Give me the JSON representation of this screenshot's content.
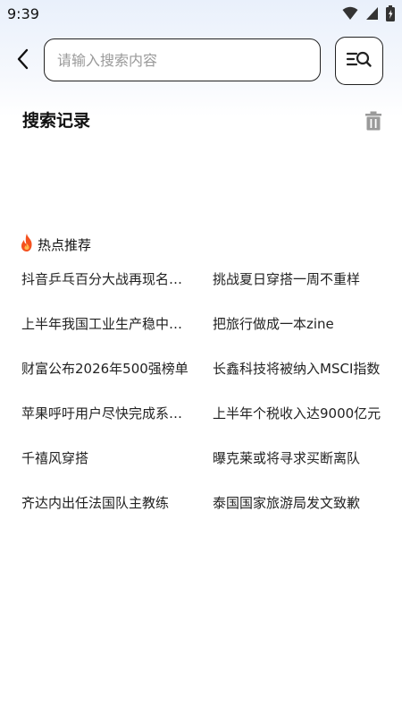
{
  "status_bar": {
    "time": "9:39",
    "icons": [
      "wifi-icon",
      "signal-icon",
      "battery-icon"
    ]
  },
  "header": {
    "back_icon": "chevron-left-icon",
    "search": {
      "placeholder": "请输入搜索内容",
      "value": ""
    },
    "search_button_icon": "search-list-icon"
  },
  "history": {
    "title": "搜索记录",
    "clear_icon": "trash-icon",
    "items": []
  },
  "hot": {
    "title": "热点推荐",
    "icon": "fire-icon",
    "accent": "#f4511e",
    "items": [
      "抖音乒乓百分大战再现名场面",
      "挑战夏日穿搭一周不重样",
      "上半年我国工业生产稳中有进",
      "把旅行做成一本zine",
      "财富公布2026年500强榜单",
      "长鑫科技将被纳入MSCI指数",
      "苹果呼吁用户尽快完成系统更新",
      "上半年个税收入达9000亿元",
      "千禧风穿搭",
      "曝克莱或将寻求买断离队",
      "齐达内出任法国队主教练",
      "泰国国家旅游局发文致歉"
    ]
  }
}
